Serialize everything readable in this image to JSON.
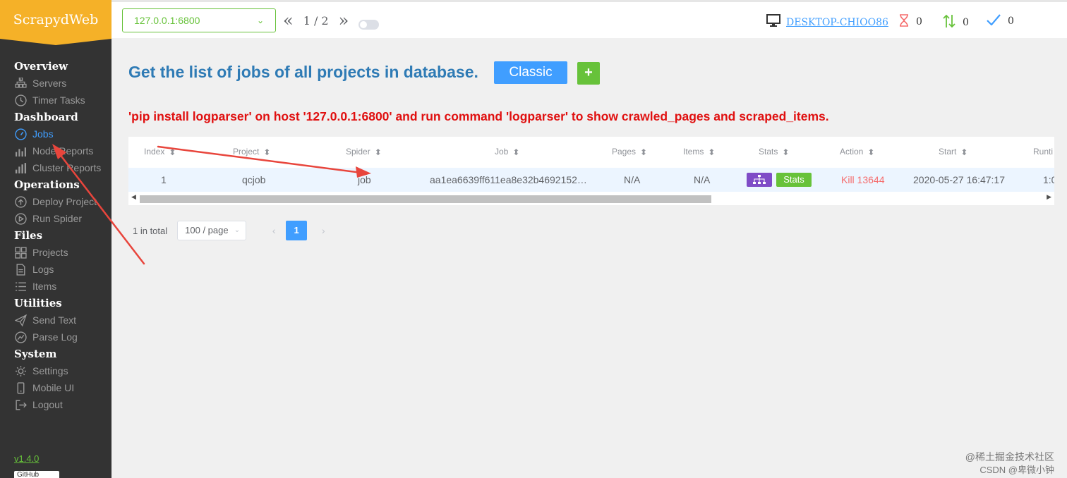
{
  "app": {
    "logo": "ScrapydWeb",
    "version": "v1.4.0",
    "github": "GitHub"
  },
  "nav": [
    {
      "group": "Overview",
      "items": [
        {
          "label": "Servers",
          "icon": "servers-icon",
          "active": false
        },
        {
          "label": "Timer Tasks",
          "icon": "clock-icon",
          "active": false
        }
      ]
    },
    {
      "group": "Dashboard",
      "items": [
        {
          "label": "Jobs",
          "icon": "gauge-icon",
          "active": true
        },
        {
          "label": "Node Reports",
          "icon": "bar-chart-icon",
          "active": false
        },
        {
          "label": "Cluster Reports",
          "icon": "bar-chart-full-icon",
          "active": false
        }
      ]
    },
    {
      "group": "Operations",
      "items": [
        {
          "label": "Deploy Project",
          "icon": "upload-icon",
          "active": false
        },
        {
          "label": "Run Spider",
          "icon": "play-icon",
          "active": false
        }
      ]
    },
    {
      "group": "Files",
      "items": [
        {
          "label": "Projects",
          "icon": "grid-icon",
          "active": false
        },
        {
          "label": "Logs",
          "icon": "document-icon",
          "active": false
        },
        {
          "label": "Items",
          "icon": "list-icon",
          "active": false
        }
      ]
    },
    {
      "group": "Utilities",
      "items": [
        {
          "label": "Send Text",
          "icon": "send-icon",
          "active": false
        },
        {
          "label": "Parse Log",
          "icon": "chart-circle-icon",
          "active": false
        }
      ]
    },
    {
      "group": "System",
      "items": [
        {
          "label": "Settings",
          "icon": "gear-icon",
          "active": false
        },
        {
          "label": "Mobile UI",
          "icon": "mobile-icon",
          "active": false
        },
        {
          "label": "Logout",
          "icon": "logout-icon",
          "active": false
        }
      ]
    }
  ],
  "topbar": {
    "server": "127.0.0.1:6800",
    "page_prev": "«",
    "page_next": "»",
    "page_indicator": "1 / 2",
    "hostname": "DESKTOP-CHIOO86",
    "pending": "0",
    "running": "0",
    "finished": "0"
  },
  "main": {
    "title": "Get the list of jobs of all projects in database.",
    "classic_btn": "Classic",
    "plus_btn": "+",
    "warning": "'pip install logparser' on host '127.0.0.1:6800' and run command 'logparser' to show crawled_pages and scraped_items."
  },
  "table": {
    "columns": [
      "Index",
      "Project",
      "Spider",
      "Job",
      "Pages",
      "Items",
      "Stats",
      "Action",
      "Start",
      "Runti"
    ],
    "row": {
      "index": "1",
      "project": "qcjob",
      "spider": "job",
      "job": "aa1ea6639ff611ea8e32b4692152…",
      "pages": "N/A",
      "items": "N/A",
      "stats_btn": "Stats",
      "action": "Kill 13644",
      "start": "2020-05-27 16:47:17",
      "runtime": "1:0"
    }
  },
  "pagination": {
    "total": "1 in total",
    "page_size": "100 / page",
    "current": "1"
  },
  "watermark": {
    "line1": "@稀土掘金技术社区",
    "line2": "CSDN @卑微小钟"
  },
  "colors": {
    "sidebar": "#333333",
    "logo": "#f5b128",
    "accent": "#409eff",
    "green": "#67c23a",
    "red": "#e01010",
    "purple": "#7f4cc7",
    "annotation": "#e8453c"
  }
}
